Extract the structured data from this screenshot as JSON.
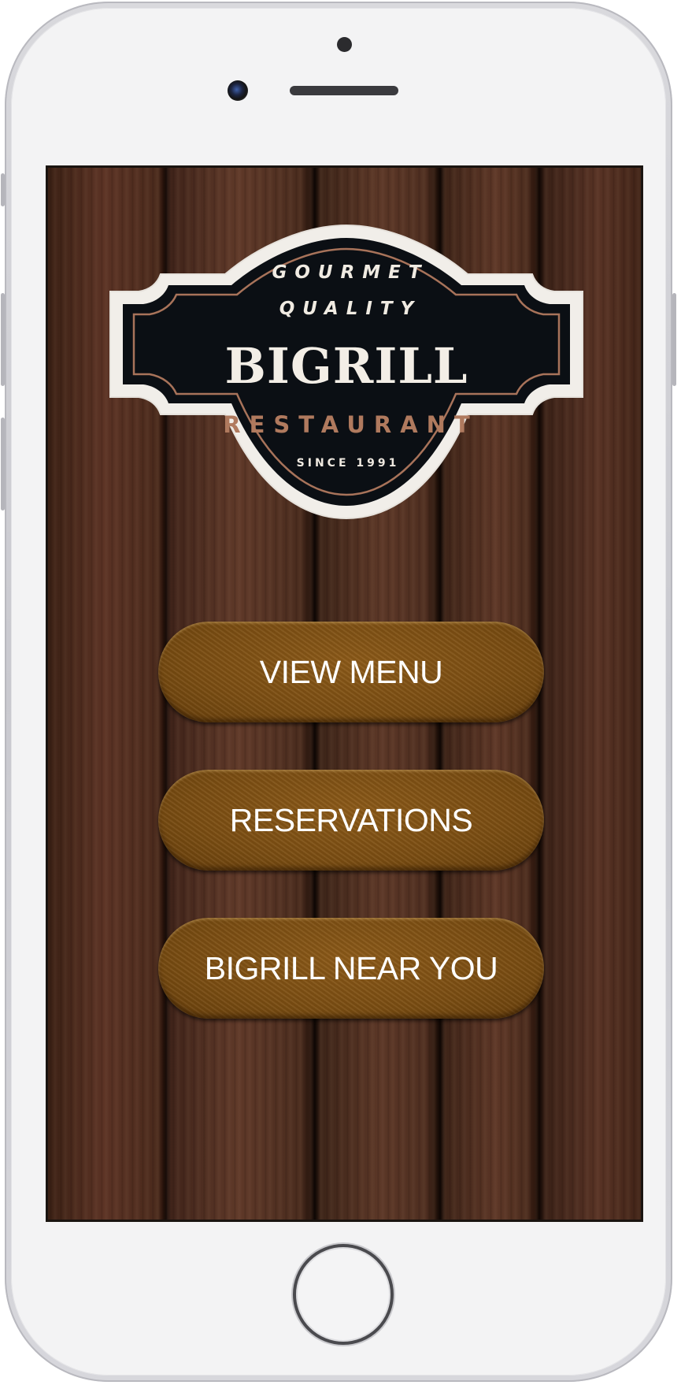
{
  "logo": {
    "line1": "GOURMET",
    "line2": "QUALITY",
    "brand": "BIGRILL",
    "subtitle": "RESTAURANT",
    "since": "SINCE 1991"
  },
  "menu": {
    "buttons": [
      {
        "label": "VIEW MENU"
      },
      {
        "label": "RESERVATIONS"
      },
      {
        "label": "BIGRILL NEAR YOU"
      }
    ]
  },
  "colors": {
    "button_brown": "#7a4d12",
    "logo_dark": "#0b0f14",
    "logo_accent": "#b07a5e",
    "wood": "#4a2a1c"
  }
}
